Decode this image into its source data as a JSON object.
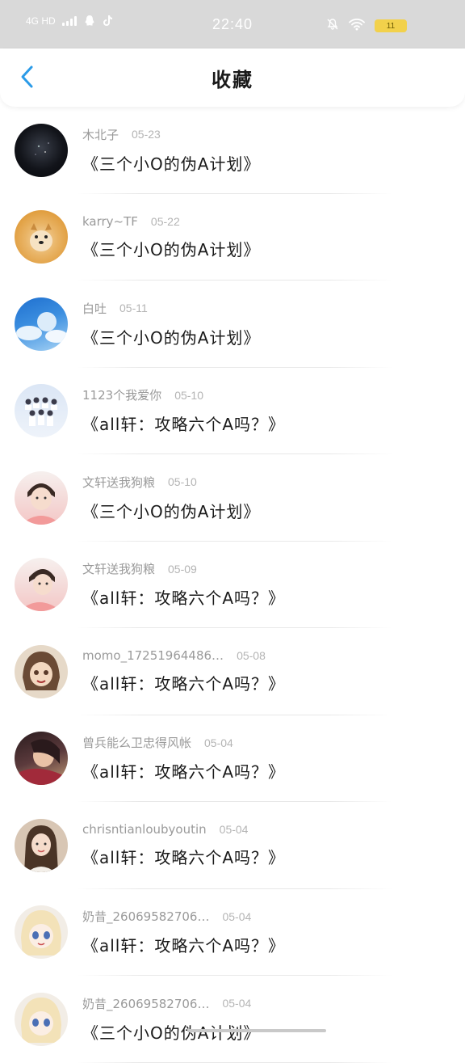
{
  "status_bar": {
    "network": "4G HD",
    "time": "22:40",
    "battery": "11"
  },
  "header": {
    "title": "收藏"
  },
  "favorites": [
    {
      "author": "木北子",
      "date": "05-23",
      "title": "《三个小O的伪A计划》",
      "avatar": "dark-space-avatar"
    },
    {
      "author": "karry~TF",
      "date": "05-22",
      "title": "《三个小O的伪A计划》",
      "avatar": "dog-avatar"
    },
    {
      "author": "白吐",
      "date": "05-11",
      "title": "《三个小O的伪A计划》",
      "avatar": "sky-avatar"
    },
    {
      "author": "1123个我爱你",
      "date": "05-10",
      "title": "《all轩：攻略六个A吗？》",
      "avatar": "group-avatar"
    },
    {
      "author": "文轩送我狗粮",
      "date": "05-10",
      "title": "《三个小O的伪A计划》",
      "avatar": "boy-pink-avatar"
    },
    {
      "author": "文轩送我狗粮",
      "date": "05-09",
      "title": "《all轩：攻略六个A吗？》",
      "avatar": "boy-pink-avatar"
    },
    {
      "author": "momo_17251964486…",
      "date": "05-08",
      "title": "《all轩：攻略六个A吗？》",
      "avatar": "anime-girl-avatar"
    },
    {
      "author": "曾兵能么卫忠得风帐",
      "date": "05-04",
      "title": "《all轩：攻略六个A吗？》",
      "avatar": "portrait-avatar"
    },
    {
      "author": "chrisntianloubyoutin",
      "date": "05-04",
      "title": "《all轩：攻略六个A吗？》",
      "avatar": "girl-avatar"
    },
    {
      "author": "奶昔_26069582706…",
      "date": "05-04",
      "title": "《all轩：攻略六个A吗？》",
      "avatar": "anime-blonde-avatar"
    },
    {
      "author": "奶昔_26069582706…",
      "date": "05-04",
      "title": "《三个小O的伪A计划》",
      "avatar": "anime-blonde-avatar"
    }
  ],
  "colors": {
    "accent": "#2b9be8",
    "status_bar_bg": "#d9d9d9",
    "meta_text": "#9a9a9a"
  }
}
